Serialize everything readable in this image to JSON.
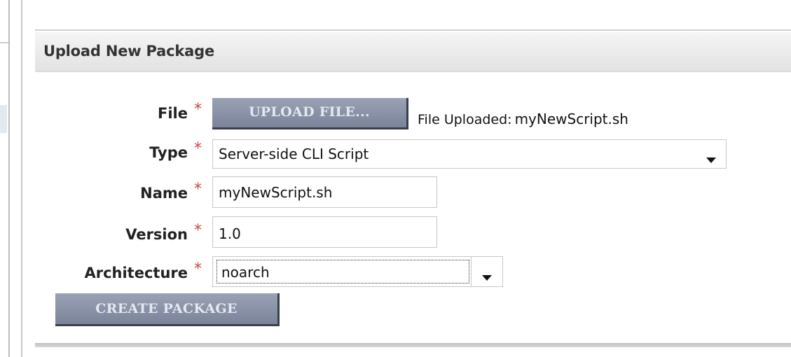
{
  "panel": {
    "title": "Upload New Package"
  },
  "form": {
    "required_marker": "*",
    "file": {
      "label": "File",
      "button_label": "UPLOAD FILE...",
      "status_prefix": "File Uploaded:",
      "status_filename": "myNewScript.sh"
    },
    "type": {
      "label": "Type",
      "selected": "Server-side CLI Script",
      "icon": "chevron-down-icon"
    },
    "name": {
      "label": "Name",
      "value": "myNewScript.sh"
    },
    "version": {
      "label": "Version",
      "value": "1.0"
    },
    "architecture": {
      "label": "Architecture",
      "selected": "noarch",
      "icon": "chevron-down-icon"
    },
    "submit_label": "CREATE PACKAGE"
  },
  "colors": {
    "required": "#d04040",
    "button_bg": "#8a92a7",
    "button_text": "#e4e8f0",
    "header_bg": "#e8e8e8"
  }
}
